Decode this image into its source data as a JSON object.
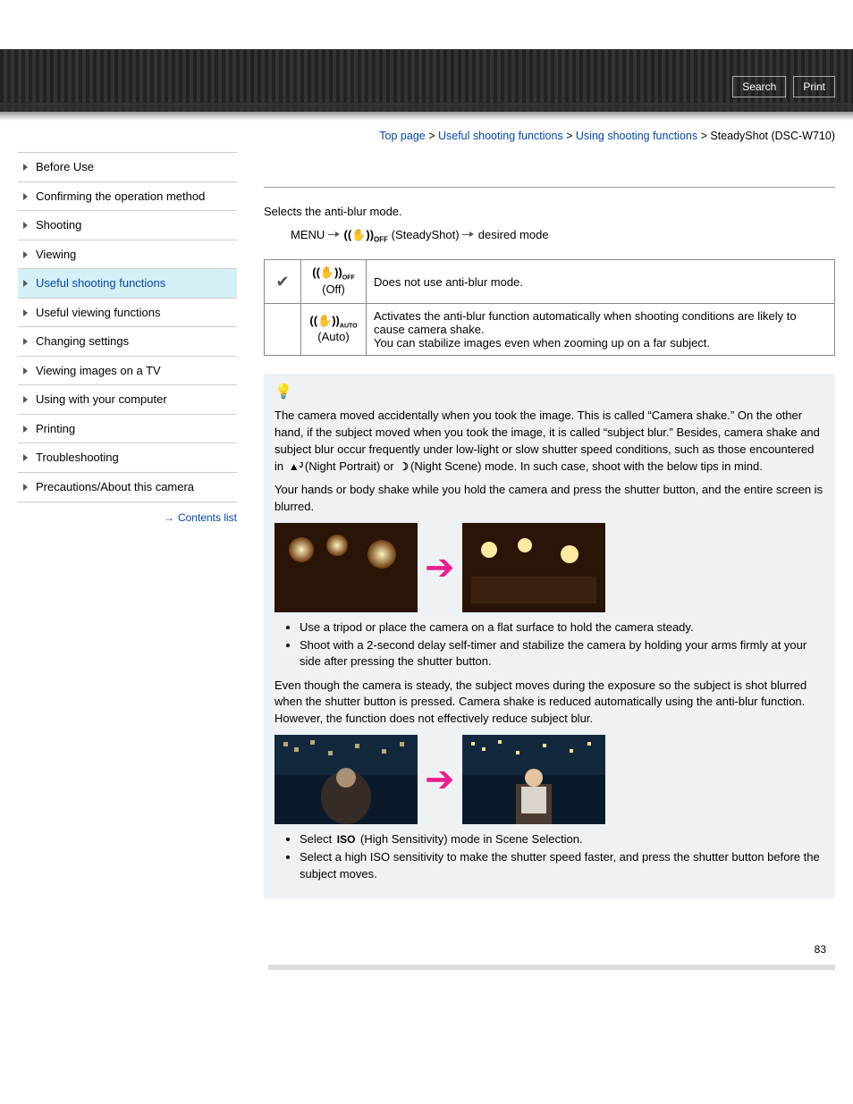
{
  "header": {
    "search": "Search",
    "print": "Print"
  },
  "breadcrumb": {
    "top": "Top page",
    "l1": "Useful shooting functions",
    "l2": "Using shooting functions",
    "l3": "SteadyShot (DSC-W710)",
    "sep": " > "
  },
  "sidebar": {
    "items": [
      "Before Use",
      "Confirming the operation method",
      "Shooting",
      "Viewing",
      "Useful shooting functions",
      "Useful viewing functions",
      "Changing settings",
      "Viewing images on a TV",
      "Using with your computer",
      "Printing",
      "Troubleshooting",
      "Precautions/About this camera"
    ],
    "active_index": 4,
    "contents_list": "Contents list"
  },
  "content": {
    "intro": "Selects the anti-blur mode.",
    "menu_label": "MENU",
    "menu_steady": "(SteadyShot)",
    "menu_desired": " desired mode",
    "table": {
      "rows": [
        {
          "mode": "(Off)",
          "desc": "Does not use anti-blur mode."
        },
        {
          "mode": "(Auto)",
          "desc": "Activates the anti-blur function automatically when shooting conditions are likely to cause camera shake.\nYou can stabilize images even when zooming up on a far subject."
        }
      ]
    },
    "tip": {
      "p1a": "The camera moved accidentally when you took the image. This is called “Camera shake.” On the other hand, if the subject moved when you took the image, it is called “subject blur.” Besides, camera shake and subject blur occur frequently under low-light or slow shutter speed conditions, such as those encountered in ",
      "p1_np": "(Night Portrait) or ",
      "p1_ns": "(Night Scene) mode. In such case, shoot with the below tips in mind.",
      "p2": "Your hands or body shake while you hold the camera and press the shutter button, and the entire screen is blurred.",
      "bullets1": [
        "Use a tripod or place the camera on a flat surface to hold the camera steady.",
        "Shoot with a 2-second delay self-timer and stabilize the camera by holding your arms firmly at your side after pressing the shutter button."
      ],
      "p3": "Even though the camera is steady, the subject moves during the exposure so the subject is shot blurred when the shutter button is pressed. Camera shake is reduced automatically using the anti-blur function. However, the function does not effectively reduce subject blur.",
      "bullets2": [
        "Select      (High Sensitivity) mode in Scene Selection.",
        "Select a high ISO sensitivity to make the shutter speed faster, and press the shutter button before the subject moves."
      ],
      "iso_label": "ISO",
      "b2_prefix": "Select ",
      "b2_suffix": "(High Sensitivity) mode in Scene Selection."
    },
    "page_number": "83"
  }
}
